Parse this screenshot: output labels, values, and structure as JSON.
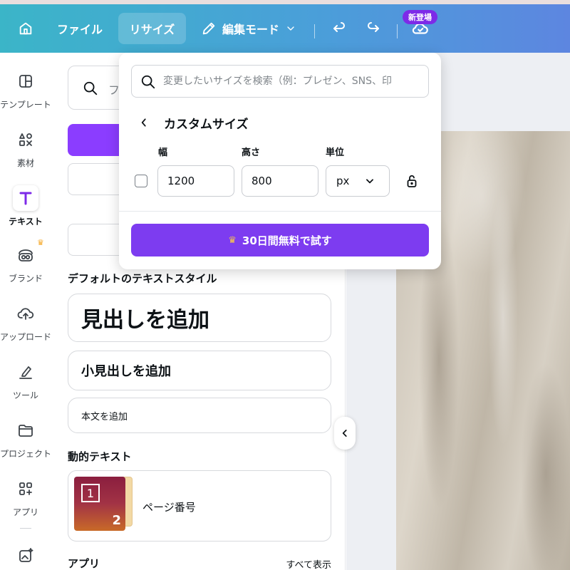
{
  "topbar": {
    "file_label": "ファイル",
    "resize_label": "リサイズ",
    "edit_mode_label": "編集モード",
    "new_badge": "新登場",
    "accent_colors": [
      "#3bb5c8",
      "#5d86e0"
    ]
  },
  "sidebar": {
    "items": [
      {
        "label": "テンプレート",
        "icon": "template-icon"
      },
      {
        "label": "素材",
        "icon": "elements-icon"
      },
      {
        "label": "テキスト",
        "icon": "text-icon"
      },
      {
        "label": "ブランド",
        "icon": "brand-icon"
      },
      {
        "label": "アップロード",
        "icon": "upload-icon"
      },
      {
        "label": "ツール",
        "icon": "draw-icon"
      },
      {
        "label": "プロジェクト",
        "icon": "folder-icon"
      },
      {
        "label": "アプリ",
        "icon": "apps-icon"
      }
    ]
  },
  "panel": {
    "search_fragment": "フ",
    "default_styles_title": "デフォルトのテキストスタイル",
    "heading_label": "見出しを追加",
    "subheading_label": "小見出しを追加",
    "body_label": "本文を追加",
    "dynamic_title": "動的テキスト",
    "page_number_label": "ページ番号",
    "thumb_num1": "1",
    "thumb_num2": "2",
    "apps_title": "アプリ",
    "see_all": "すべて表示"
  },
  "popover": {
    "search_placeholder": "変更したいサイズを検索（例：プレゼン、SNS、印",
    "title": "カスタムサイズ",
    "width_label": "幅",
    "height_label": "高さ",
    "unit_label": "単位",
    "width_value": "1200",
    "height_value": "800",
    "unit_value": "px",
    "trial_label": "30日間無料で試す",
    "accent": "#7d3cf0"
  }
}
